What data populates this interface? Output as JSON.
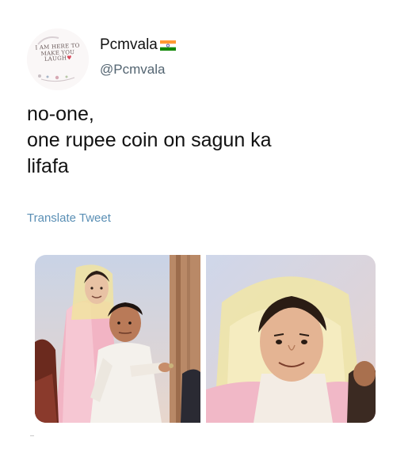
{
  "author": {
    "display_name": "Pcmvala",
    "handle": "@Pcmvala",
    "flag_icon": "india-flag-icon",
    "avatar_text_lines": [
      "I AM HERE TO",
      "MAKE YOU",
      "LAUGH"
    ]
  },
  "tweet": {
    "text_lines": [
      "no-one,",
      "one rupee coin on sagun ka",
      "lifafa"
    ],
    "translate_label": "Translate Tweet"
  },
  "media": {
    "left_image": "meme-man-with-coin-image",
    "right_image": "meme-face-closeup-image"
  },
  "colors": {
    "link": "#5a8fb5",
    "handle": "#536471",
    "text": "#111111",
    "background": "#ffffff"
  }
}
